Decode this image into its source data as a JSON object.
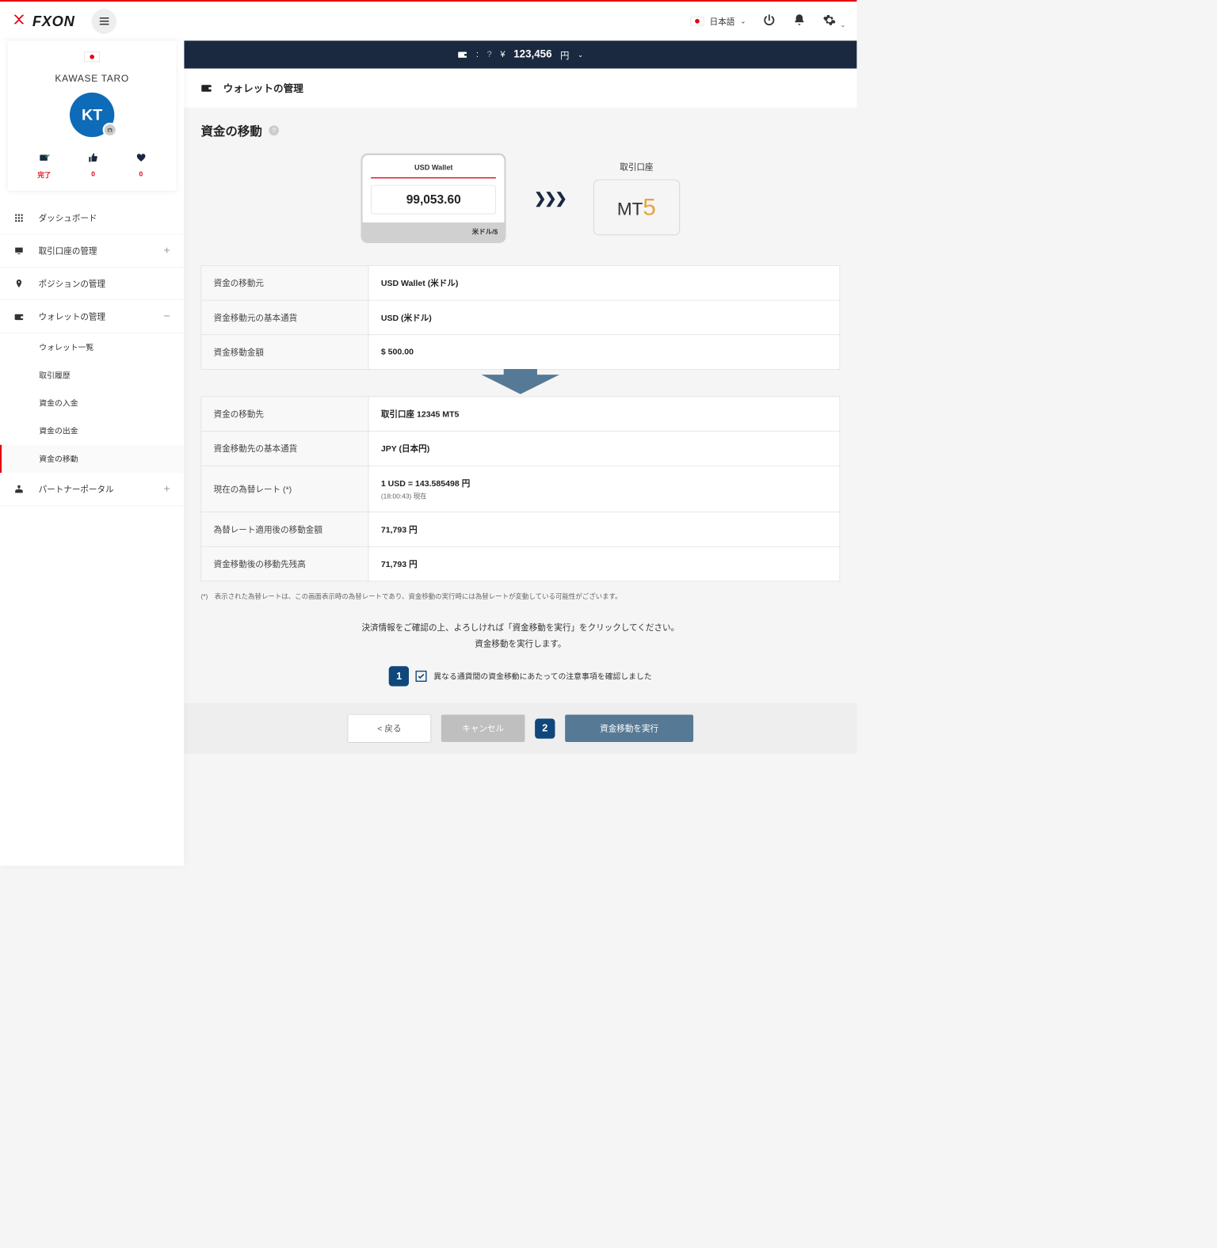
{
  "header": {
    "logo_text": "FXON",
    "language": "日本語"
  },
  "balance_bar": {
    "currency_symbol": "¥",
    "amount": "123,456",
    "unit": "円"
  },
  "profile": {
    "name": "KAWASE TARO",
    "initials": "KT",
    "stats": {
      "complete": "完了",
      "thumb": "0",
      "heart": "0"
    }
  },
  "nav": {
    "dashboard": "ダッシュボード",
    "accounts": "取引口座の管理",
    "positions": "ポジションの管理",
    "wallet": "ウォレットの管理",
    "wallet_sub": {
      "list": "ウォレット一覧",
      "history": "取引履歴",
      "deposit": "資金の入金",
      "withdraw": "資金の出金",
      "transfer": "資金の移動"
    },
    "partner": "パートナーポータル"
  },
  "page": {
    "title": "ウォレットの管理",
    "section_title": "資金の移動"
  },
  "transfer": {
    "wallet_title": "USD Wallet",
    "wallet_amount": "99,053.60",
    "wallet_currency": "米ドル/$",
    "dest_label": "取引口座",
    "mt": "MT",
    "five": "5"
  },
  "table1": {
    "r1_label": "資金の移動元",
    "r1_value": "USD Wallet (米ドル)",
    "r2_label": "資金移動元の基本通貨",
    "r2_value": "USD (米ドル)",
    "r3_label": "資金移動金額",
    "r3_value": "$ 500.00"
  },
  "table2": {
    "r1_label": "資金の移動先",
    "r1_value": "取引口座 12345 MT5",
    "r2_label": "資金移動先の基本通貨",
    "r2_value": "JPY (日本円)",
    "r3_label": "現在の為替レート (*)",
    "r3_value": "1 USD = 143.585498 円",
    "r3_time": "(18:00:43) 現在",
    "r4_label": "為替レート適用後の移動金額",
    "r4_value": "71,793 円",
    "r5_label": "資金移動後の移動先残高",
    "r5_value": "71,793 円"
  },
  "note": "(*)　表示された為替レートは、この画面表示時の為替レートであり、資金移動の実行時には為替レートが変動している可能性がございます。",
  "confirm": {
    "line1": "決済情報をご確認の上、よろしければ「資金移動を実行」をクリックしてください。",
    "line2": "資金移動を実行します。"
  },
  "checkbox": {
    "badge1": "1",
    "label": "異なる通貨間の資金移動にあたっての注意事項を確認しました"
  },
  "buttons": {
    "back": "< 戻る",
    "cancel": "キャンセル",
    "badge2": "2",
    "submit": "資金移動を実行"
  }
}
